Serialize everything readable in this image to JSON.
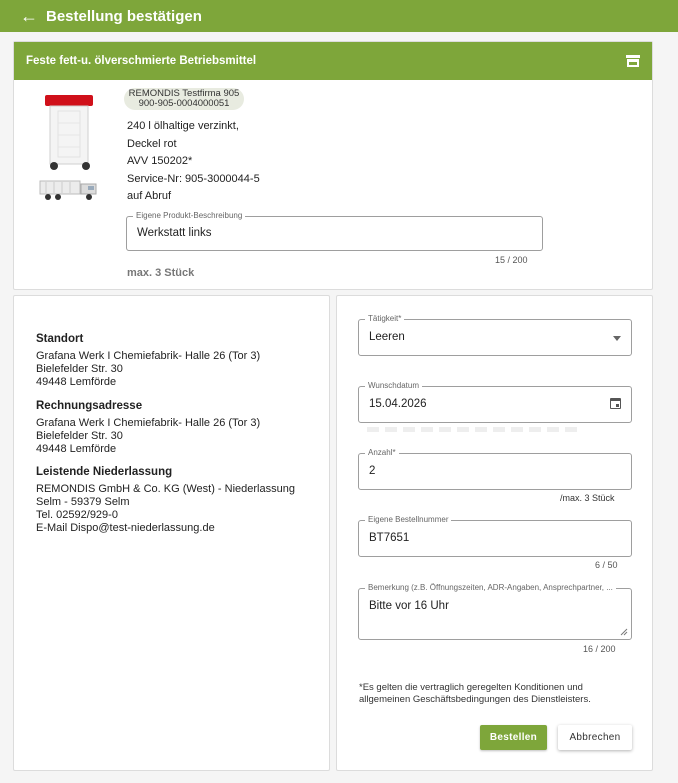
{
  "header": {
    "title": "Bestellung bestätigen",
    "back_icon": "arrow-left-icon"
  },
  "product": {
    "title": "Feste fett-u. ölverschmierte Betriebsmittel",
    "header_icon": "store-icon",
    "chip_company": "REMONDIS Testfirma 905",
    "chip_number": "900-905-0004000051",
    "description_lines": [
      "240 l ölhaltige verzinkt,",
      "Deckel rot",
      "AVV 150202*",
      "Service-Nr: 905-3000044-5",
      "auf Abruf"
    ],
    "own_description_label": "Eigene Produkt-Beschreibung",
    "own_description_value": "Werkstatt links",
    "own_description_counter": "15 / 200",
    "max_quantity": "max. 3 Stück",
    "colors": {
      "accent": "#7ea63a",
      "lid": "#d0101a"
    }
  },
  "addresses": {
    "location_heading": "Standort",
    "location_lines": [
      "Grafana Werk I Chemiefabrik- Halle 26 (Tor 3)",
      "Bielefelder Str. 30",
      "49448 Lemförde"
    ],
    "billing_heading": "Rechnungsadresse",
    "billing_lines": [
      "Grafana Werk I Chemiefabrik- Halle 26 (Tor 3)",
      "Bielefelder Str. 30",
      "49448 Lemförde"
    ],
    "branch_heading": "Leistende Niederlassung",
    "branch_lines": [
      "REMONDIS GmbH & Co. KG (West) - Niederlassung",
      "Selm - 59379 Selm",
      "Tel. 02592/929-0",
      "E-Mail Dispo@test-niederlassung.de"
    ]
  },
  "form": {
    "activity_label": "Tätigkeit*",
    "activity_value": "Leeren",
    "date_label": "Wunschdatum",
    "date_value": "15.04.2026",
    "quantity_label": "Anzahl*",
    "quantity_value": "2",
    "quantity_hint": "/max. 3 Stück",
    "order_no_label": "Eigene Bestellnummer",
    "order_no_value": "BT7651",
    "order_no_counter": "6 / 50",
    "remark_label": "Bemerkung (z.B. Öffnungszeiten, ADR-Angaben, Ansprechpartner, ...",
    "remark_value": "Bitte vor 16 Uhr",
    "remark_counter": "16 / 200",
    "terms": "*Es gelten die vertraglich geregelten Konditionen und allgemeinen Geschäftsbedingungen des Dienstleisters.",
    "submit_label": "Bestellen",
    "cancel_label": "Abbrechen"
  }
}
